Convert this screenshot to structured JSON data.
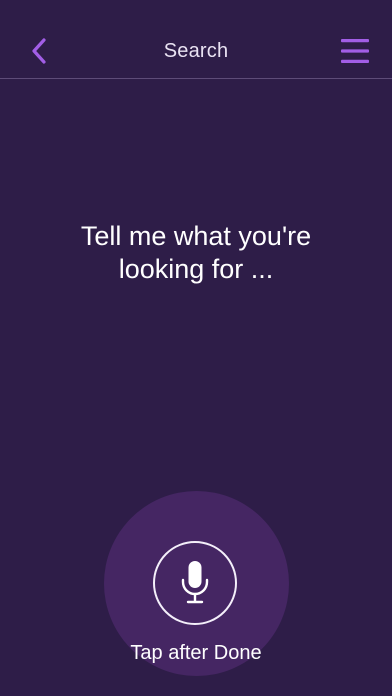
{
  "header": {
    "title": "Search",
    "back_icon": "chevron-left-icon",
    "menu_icon": "hamburger-menu-icon"
  },
  "main": {
    "prompt": "Tell me what you're\nlooking for ..."
  },
  "voice": {
    "mic_icon": "microphone-icon",
    "hint": "Tap after Done"
  },
  "colors": {
    "background": "#2e1d48",
    "accent": "#a25ee6",
    "halo": "#452663",
    "divider": "#5e4c78"
  }
}
